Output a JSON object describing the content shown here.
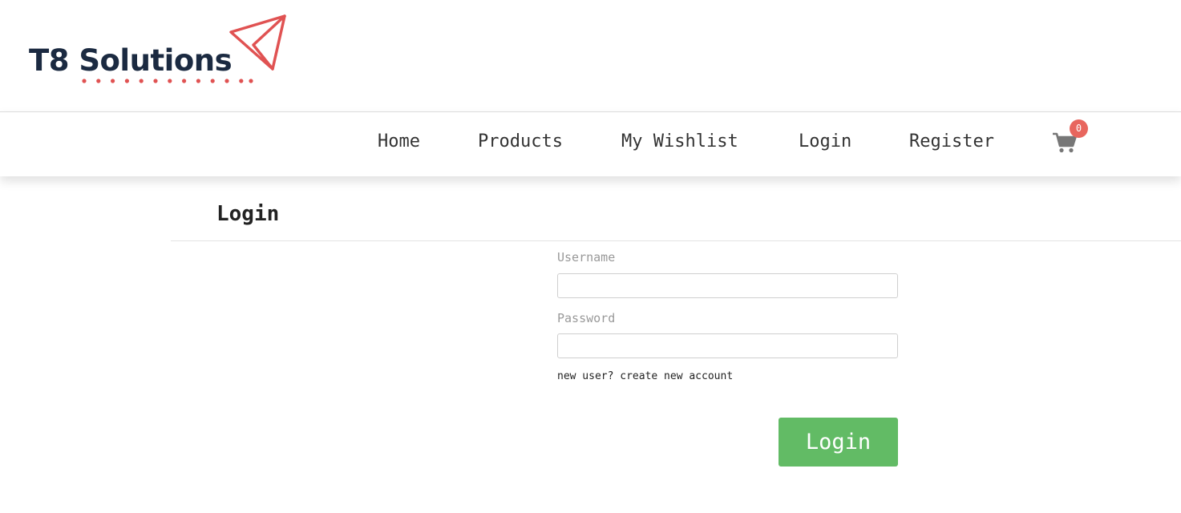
{
  "brand": {
    "name": "T8 Solutions",
    "accent_color": "#e05252",
    "text_color": "#1b2a41"
  },
  "nav": {
    "items": [
      {
        "label": "Home"
      },
      {
        "label": "Products"
      },
      {
        "label": "My Wishlist"
      },
      {
        "label": "Login"
      },
      {
        "label": "Register"
      }
    ],
    "cart": {
      "icon": "cart-icon",
      "count": "0",
      "badge_color": "#e8665e"
    }
  },
  "page": {
    "title": "Login"
  },
  "form": {
    "username": {
      "label": "Username",
      "value": "",
      "placeholder": ""
    },
    "password": {
      "label": "Password",
      "value": "",
      "placeholder": ""
    },
    "new_user_link": "new user? create new account",
    "submit_label": "Login",
    "submit_color": "#62bb65"
  }
}
